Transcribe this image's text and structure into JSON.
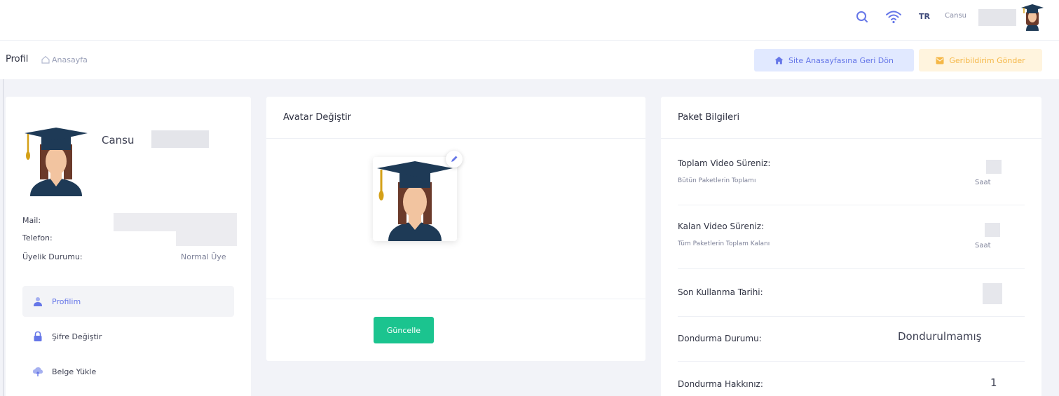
{
  "header": {
    "language": "TR",
    "user_name": "Cansu",
    "icons": [
      "search-icon",
      "wifi-icon",
      "avatar"
    ]
  },
  "subheader": {
    "title": "Profil",
    "breadcrumb": "Anasayfa",
    "site_home_button": "Site Anasayfasına Geri Dön",
    "feedback_button": "Geribildirim Gönder"
  },
  "profile": {
    "name": "Cansu",
    "mail_label": "Mail:",
    "phone_label": "Telefon:",
    "membership_label": "Üyelik Durumu:",
    "membership_value": "Normal Üye",
    "nav": [
      {
        "label": "Profilim",
        "icon": "user-icon",
        "active": true
      },
      {
        "label": "Şifre Değiştir",
        "icon": "lock-icon",
        "active": false
      },
      {
        "label": "Belge Yükle",
        "icon": "upload-icon",
        "active": false
      }
    ]
  },
  "avatar_card": {
    "title": "Avatar Değiştir",
    "update_button": "Güncelle"
  },
  "package_card": {
    "title": "Paket Bilgileri",
    "rows": [
      {
        "label": "Toplam Video Süreniz:",
        "sub": "Bütün Paketlerin Toplamı",
        "unit": "Saat"
      },
      {
        "label": "Kalan Video Süreniz:",
        "sub": "Tüm Paketlerin Toplam Kalanı",
        "unit": "Saat"
      },
      {
        "label": "Son Kullanma Tarihi:"
      },
      {
        "label": "Dondurma Durumu:",
        "value": "Dondurulmamış"
      },
      {
        "label": "Dondurma Hakkınız:",
        "value": "1"
      }
    ]
  },
  "colors": {
    "primary": "#6576e8",
    "success": "#1bc48f",
    "warning": "#f5b746",
    "navy": "#1e3a56",
    "skin": "#f2c4a0",
    "hair": "#6b3a2a"
  }
}
